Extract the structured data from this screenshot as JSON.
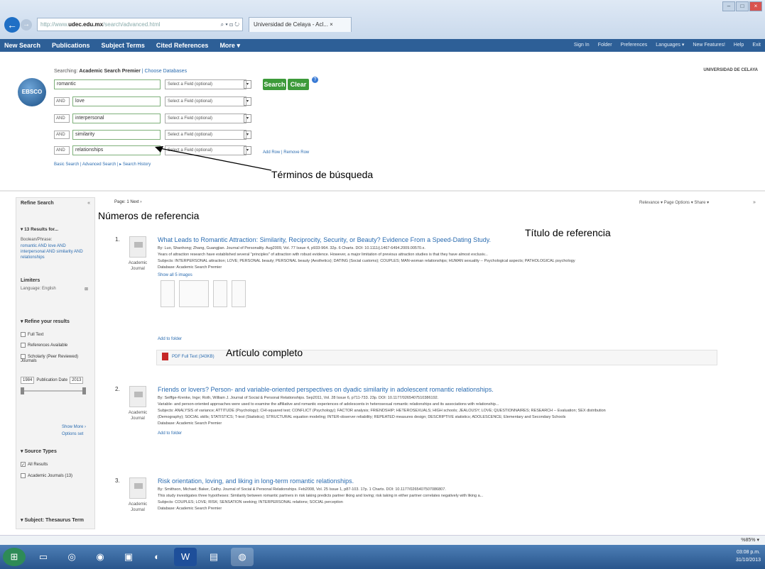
{
  "browser": {
    "address_prefix": "http://www.",
    "address_domain": "udec.edu.mx",
    "address_rest": "/search/advanced.html",
    "address_controls": "⌕ ▾ ⊡ ↻",
    "tab_label": "Universidad de Celaya - Acl... ×",
    "win_min": "–",
    "win_max": "□",
    "win_close": "×"
  },
  "nav": {
    "left": [
      "New Search",
      "Publications",
      "Subject Terms",
      "Cited References",
      "More ▾"
    ],
    "right": [
      "Sign In",
      "Folder",
      "Preferences",
      "Languages ▾",
      "New Features!",
      "Help",
      "Exit"
    ]
  },
  "logo_text": "EBSCO",
  "search": {
    "searching_prefix": "Searching:",
    "database": "Academic Search Premier",
    "choose": "| Choose Databases",
    "rows": [
      {
        "bool": "",
        "term": "romantic",
        "field": "Select a Field (optional)"
      },
      {
        "bool": "AND",
        "term": "love",
        "field": "Select a Field (optional)"
      },
      {
        "bool": "AND",
        "term": "interpersonal",
        "field": "Select a Field (optional)"
      },
      {
        "bool": "AND",
        "term": "similarity",
        "field": "Select a Field (optional)"
      },
      {
        "bool": "AND",
        "term": "relationships",
        "field": "Select a Field (optional)"
      }
    ],
    "search_label": "Search",
    "clear_label": "Clear",
    "add_remove": "Add Row | Remove Row",
    "links": "Basic Search | Advanced Search | ▸ Search History",
    "institution": "UNIVERSIDAD DE CELAYA"
  },
  "annotations": {
    "terms": "Términos de búsqueda",
    "nums": "Números de referencia",
    "title": "Título de referencia",
    "full": "Artículo completo"
  },
  "sidebar": {
    "title": "Refine Search",
    "results_for": "▾ 13 Results for...",
    "boolean_label": "Boolean/Phrase:",
    "boolean_value": "romantic AND love AND interpersonal AND similarity AND relationships",
    "limiters": "Limiters",
    "language": "Language: English",
    "refine": "▾ Refine your results",
    "fulltext": "Full Text",
    "refs": "References Available",
    "scholarly": "Scholarly (Peer Reviewed) Journals",
    "year_from": "1984",
    "pubdate": "Publication Date",
    "year_to": "2013",
    "show_more": "Show More ›",
    "options": "Options set",
    "source_types": "▾ Source Types",
    "all_results": "All Results",
    "acad": "Academic Journals (13)",
    "subject": "▾ Subject: Thesaurus Term"
  },
  "pagebar": "Page: 1  Next ›",
  "sortbar": "Relevance ▾  Page Options ▾  Share ▾",
  "results": [
    {
      "num": "1.",
      "type": "Academic Journal",
      "title": "What Leads to Romantic Attraction: Similarity, Reciprocity, Security, or Beauty? Evidence From a Speed-Dating Study.",
      "by": "By: Luo, Shanhong; Zhang, Guangjian. Journal of Personality. Aug2009, Vol. 77 Issue 4, p933-964. 32p. 6 Charts. DOI: 10.1111/j.1467-6494.2009.00570.x.",
      "abstract": "Years of attraction research have established several \"principles\" of attraction with robust evidence. However, a major limitation of previous attraction studies is that they have almost exclusiv...",
      "subjects": "Subjects: INTERPERSONAL attraction; LOVE; PERSONAL beauty; PERSONAL beauty (Aesthetics); DATING (Social customs); COUPLES; MAN-woman relationships; HUMAN sexuality -- Psychological aspects; PATHOLOGICAL psychology",
      "database": "Database: Academic Search Premier",
      "images_link": "Show all 5 images",
      "folder": "Add to folder",
      "pdf": "PDF Full Text (343KB)"
    },
    {
      "num": "2.",
      "type": "Academic Journal",
      "title": "Friends or lovers? Person- and variable-oriented perspectives on dyadic similarity in adolescent romantic relationships.",
      "by": "By: Seiffge-Krenke, Inge; Roth, William J. Journal of Social & Personal Relationships. Sep2011, Vol. 28 Issue 6, p711-733. 23p. DOI: 10.1177/0265407510386192.",
      "abstract": "Variable- and person-oriented approaches were used to examine the affiliative and romantic experiences of adolescents in heterosexual romantic relationships and its associations with relationship...",
      "subjects": "Subjects: ANALYSIS of variance; ATTITUDE (Psychology); CHI-squared test; CONFLICT (Psychology); FACTOR analysis; FRIENDSHIP; HETEROSEXUALS; HIGH schools; JEALOUSY; LOVE; QUESTIONNAIRES; RESEARCH -- Evaluation; SEX distribution",
      "subjects2": "(Demography); SOCIAL skills; STATISTICS; T-test (Statistics); STRUCTURAL equation modeling; INTER-observer reliability; REPEATED measures design; DESCRIPTIVE statistics; ADOLESCENCE; Elementary and Secondary Schools",
      "database": "Database: Academic Search Premier",
      "folder": "Add to folder"
    },
    {
      "num": "3.",
      "type": "Academic Journal",
      "title": "Risk orientation, loving, and liking in long-term romantic relationships.",
      "by": "By: Smithson, Michael; Baker, Cathy. Journal of Social & Personal Relationships. Feb2008, Vol. 25 Issue 1, p87-103. 17p. 1 Charts. DOI: 10.1177/0265407507086807.",
      "abstract": "This study investigates three hypotheses: Similarity between romantic partners in risk taking predicts partner liking and loving; risk taking in either partner correlates negatively with liking a...",
      "subjects": "Subjects: COUPLES; LOVE; RISK; SENSATION seeking; INTERPERSONAL relations; SOCIAL perception",
      "database": "Database: Academic Search Premier"
    }
  ],
  "status_zoom": "%85% ▾",
  "clock": {
    "time": "03:08 p.m.",
    "date": "31/10/2013"
  },
  "taskbar": [
    "⊞",
    "▭",
    "◎",
    "◉",
    "▣",
    "◐",
    "W",
    "▤",
    "◍"
  ]
}
